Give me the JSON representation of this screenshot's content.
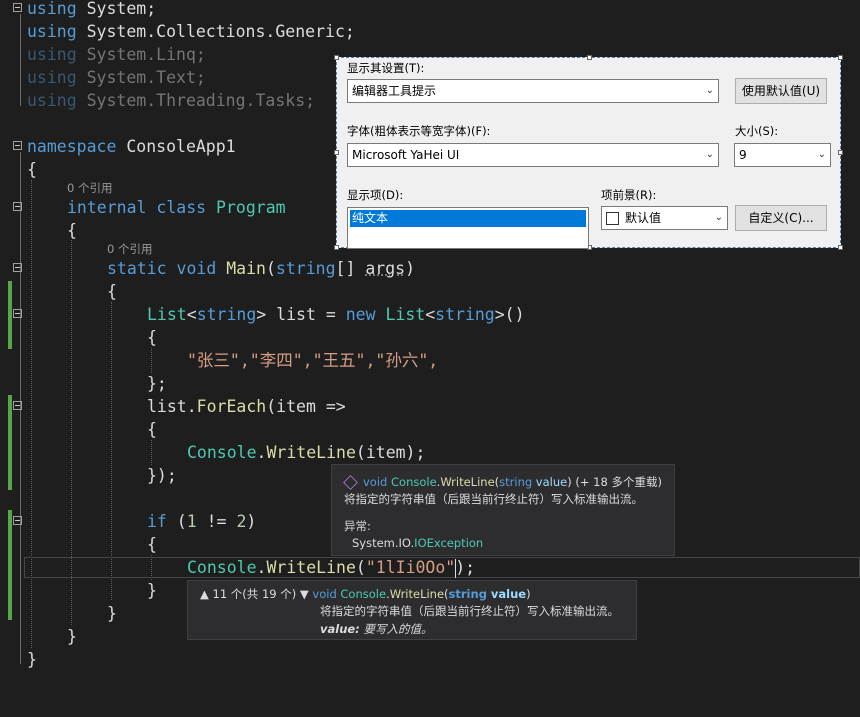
{
  "code": {
    "l1": {
      "kw": "using",
      "rest": " System;"
    },
    "l2": {
      "kw": "using",
      "rest": " System.Collections.Generic;"
    },
    "l3": {
      "kw": "using",
      "rest": " System.Linq;"
    },
    "l4": {
      "kw": "using",
      "rest": " System.Text;"
    },
    "l5": {
      "kw": "using",
      "rest": " System.Threading.Tasks;"
    },
    "l7": {
      "kw": "namespace",
      "rest": " ConsoleApp1"
    },
    "brace_open": "{",
    "brace_close": "}",
    "ref1": "0 个引用",
    "l9": {
      "kw1": "internal",
      "kw2": "class",
      "name": "Program"
    },
    "ref2": "0 个引用",
    "l11": {
      "kw1": "static",
      "kw2": "void",
      "fn": "Main",
      "p1": "(",
      "ty": "string",
      "p2": "[] ",
      "arg": "args",
      "p3": ")"
    },
    "l13": {
      "t1": "List",
      "p1": "<",
      "t2": "string",
      "p2": "> list = ",
      "kw": "new",
      "p3": " ",
      "t3": "List",
      "p4": "<",
      "t5": "string",
      "p5": ">()"
    },
    "l15": {
      "s": "\"张三\",\"李四\",\"王五\",\"孙六\","
    },
    "l16": "};",
    "l17": {
      "a": "list.",
      "fn": "ForEach",
      "b": "(item =>"
    },
    "l19": {
      "t": "Console",
      "a": ".",
      "fn": "WriteLine",
      "b": "(item);"
    },
    "l20": "});",
    "l22": {
      "kw": "if",
      "a": " (",
      "n1": "1",
      "b": " != ",
      "n2": "2",
      "c": ")"
    },
    "l24": {
      "t": "Console",
      "a": ".",
      "fn": "WriteLine",
      "b": "(",
      "s": "\"1lIi0Oo\"",
      "c": ");"
    }
  },
  "dialog": {
    "display_settings_label": "显示其设置(T):",
    "display_settings_value": "编辑器工具提示",
    "use_defaults_button": "使用默认值(U)",
    "font_label": "字体(粗体表示等宽字体)(F):",
    "font_value": "Microsoft YaHei UI",
    "size_label": "大小(S):",
    "size_value": "9",
    "display_items_label": "显示项(D):",
    "display_items_selected": "纯文本",
    "foreground_label": "项前景(R):",
    "foreground_value": "默认值",
    "custom_button": "自定义(C)..."
  },
  "tooltip1": {
    "kw": "void",
    "cls": "Console",
    "dot": ".",
    "fn": "WriteLine",
    "p1": "(",
    "ptype": "string",
    "pname": " value",
    "p2": ")",
    "overloads": " (+ 18 多个重载)",
    "desc": "将指定的字符串值（后跟当前行终止符）写入标准输出流。",
    "exceptions_label": "异常:",
    "ex_ns": "System.IO.",
    "ex_name": "IOException"
  },
  "tooltip2": {
    "counter": "11 个(共 19 个)",
    "kw": "void",
    "cls": "Console",
    "dot": ".",
    "fn": "WriteLine",
    "p1": "(",
    "ptype": "string",
    "pname": " value",
    "p2": ")",
    "desc": "将指定的字符串值（后跟当前行终止符）写入标准输出流。",
    "param_name": "value:",
    "param_desc": " 要写入的值。"
  },
  "colors": {
    "keyword": "#569cd6",
    "type": "#4ec9b0",
    "method": "#dcdcaa",
    "string": "#d69d85",
    "number": "#b5cea8",
    "changebar": "#57a64a",
    "selection": "#0078d7"
  }
}
